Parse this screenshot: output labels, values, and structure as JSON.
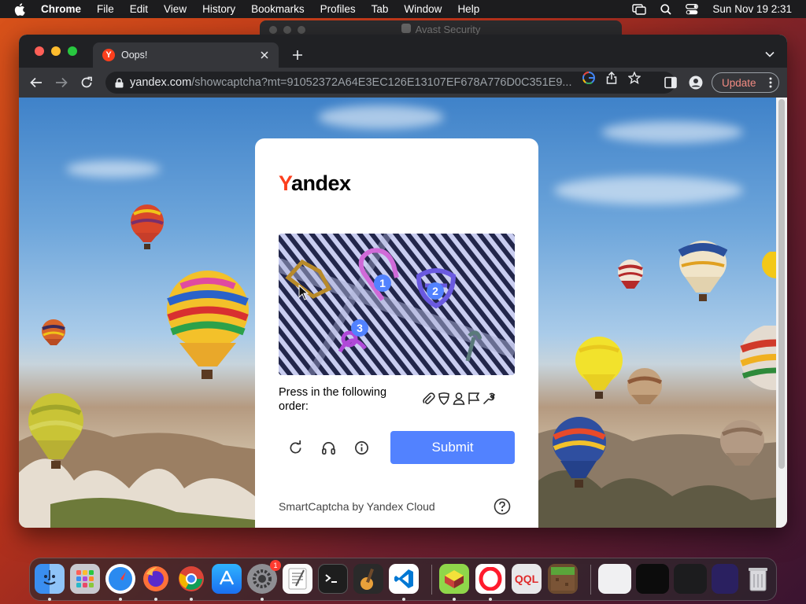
{
  "menubar": {
    "app_name": "Chrome",
    "items": [
      "File",
      "Edit",
      "View",
      "History",
      "Bookmarks",
      "Profiles",
      "Tab",
      "Window",
      "Help"
    ],
    "clock": "Sun Nov 19  2:31"
  },
  "background_window": {
    "title": "Avast Security"
  },
  "browser": {
    "tab": {
      "title": "Oops!",
      "favicon_letter": "Y"
    },
    "address": {
      "host": "yandex.com",
      "path": "/showcaptcha?mt=91052372A64E3EC126E13107EF678A776D0C351E9..."
    },
    "update_label": "Update"
  },
  "captcha": {
    "logo_first": "Y",
    "logo_rest": "andex",
    "prompt": "Press in the following order:",
    "order_icons": [
      "paperclip-icon",
      "shield-icon",
      "person-icon",
      "flag-icon",
      "wrench-icon"
    ],
    "markers": [
      "1",
      "2",
      "3"
    ],
    "submit_label": "Submit",
    "footer": "SmartCaptcha by Yandex Cloud"
  },
  "dock": {
    "apps": [
      "finder",
      "launchpad",
      "safari",
      "firefox",
      "chrome",
      "app-store",
      "system-settings",
      "textedit",
      "terminal",
      "garageband",
      "vscode",
      "minecraft-launcher",
      "opera",
      "qql",
      "minecraft",
      "trash"
    ],
    "settings_badge": "1"
  },
  "colors": {
    "accent": "#5282ff",
    "yandex_red": "#fc3f1d"
  }
}
